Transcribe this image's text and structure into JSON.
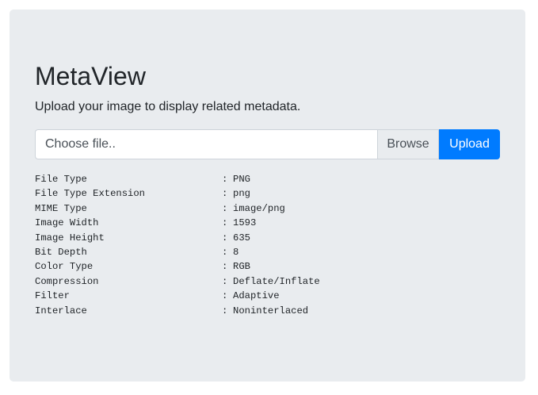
{
  "app": {
    "title": "MetaView",
    "lead": "Upload your image to display related metadata."
  },
  "upload": {
    "file_placeholder": "Choose file..",
    "browse_label": "Browse",
    "upload_label": "Upload",
    "upload_color": "#007bff"
  },
  "metadata": {
    "separator": ":",
    "rows": [
      {
        "key": "File Type",
        "value": "PNG"
      },
      {
        "key": "File Type Extension",
        "value": "png"
      },
      {
        "key": "MIME Type",
        "value": "image/png"
      },
      {
        "key": "Image Width",
        "value": "1593"
      },
      {
        "key": "Image Height",
        "value": "635"
      },
      {
        "key": "Bit Depth",
        "value": "8"
      },
      {
        "key": "Color Type",
        "value": "RGB"
      },
      {
        "key": "Compression",
        "value": "Deflate/Inflate"
      },
      {
        "key": "Filter",
        "value": "Adaptive"
      },
      {
        "key": "Interlace",
        "value": "Noninterlaced"
      }
    ]
  }
}
